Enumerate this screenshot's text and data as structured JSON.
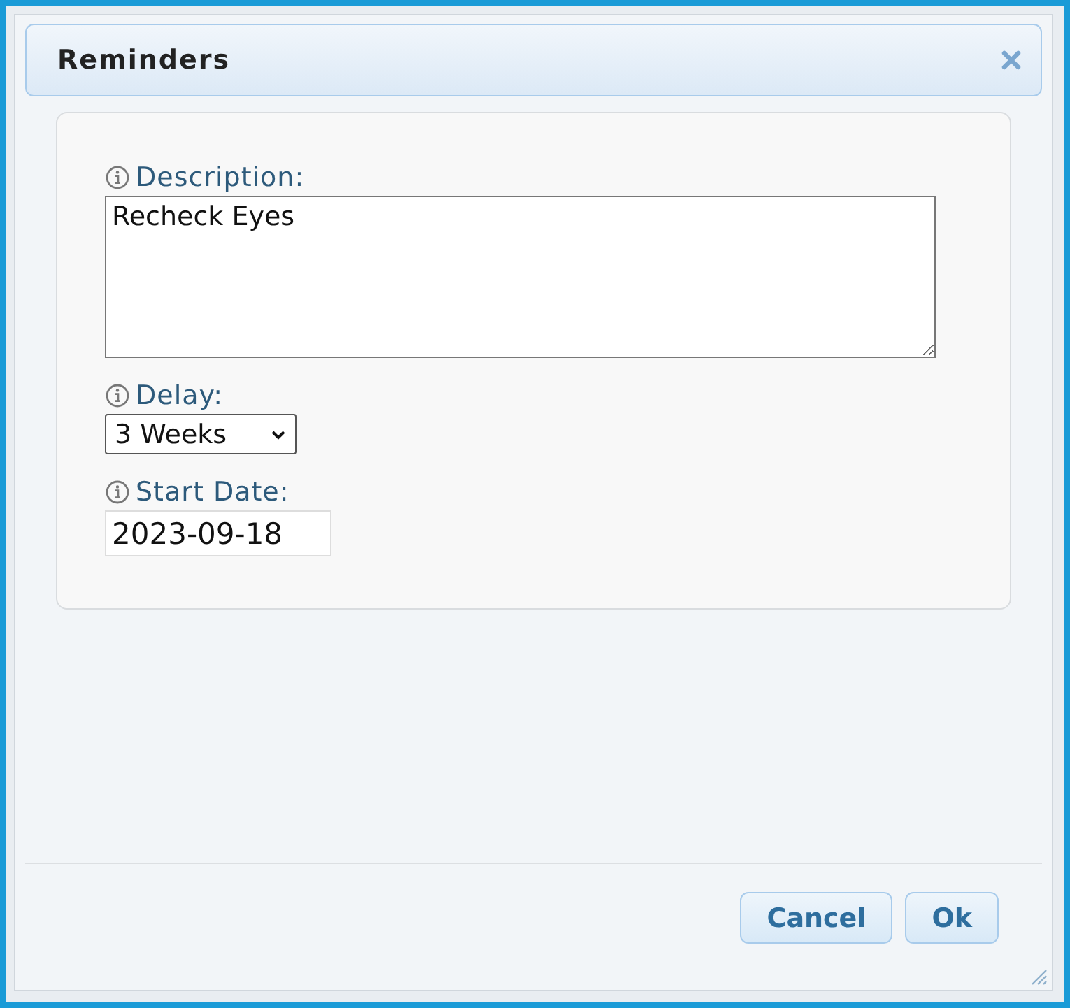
{
  "dialog": {
    "title": "Reminders"
  },
  "fields": [
    {
      "kind": "textarea",
      "label": "Description:",
      "value": "Recheck Eyes"
    },
    {
      "kind": "select",
      "label": "Delay:",
      "value": "3 Weeks"
    },
    {
      "kind": "input",
      "label": "Start Date:",
      "value": "2023-09-18"
    }
  ],
  "buttons": [
    "Cancel",
    "Ok"
  ]
}
